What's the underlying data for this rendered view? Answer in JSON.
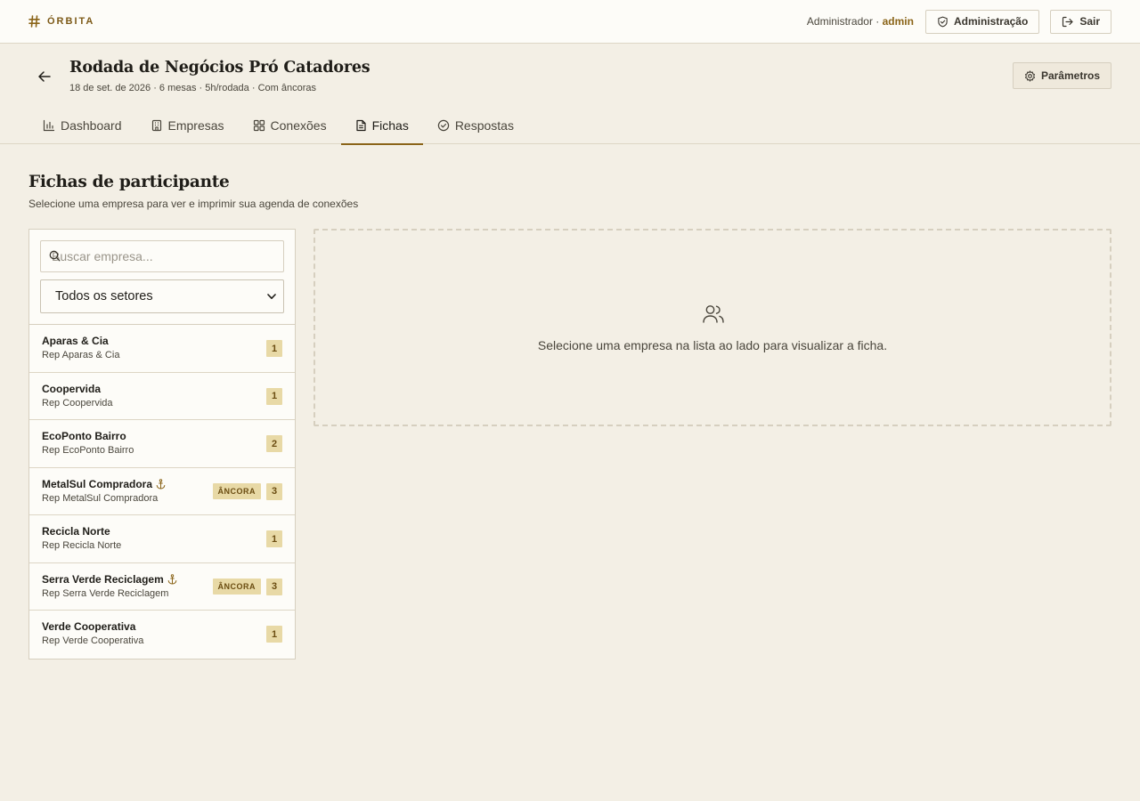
{
  "app": {
    "brand": "ÓRBITA",
    "user_role": "Administrador ·",
    "username": "admin",
    "admin_button": "Administração",
    "logout_button": "Sair"
  },
  "event": {
    "title": "Rodada de Negócios Pró Catadores",
    "meta": "18 de set. de 2026 · 6 mesas · 5h/rodada · Com âncoras",
    "params_button": "Parâmetros"
  },
  "tabs": [
    {
      "label": "Dashboard",
      "icon": "bar-chart-icon"
    },
    {
      "label": "Empresas",
      "icon": "building-icon"
    },
    {
      "label": "Conexões",
      "icon": "grid-icon"
    },
    {
      "label": "Fichas",
      "icon": "document-icon",
      "active": true
    },
    {
      "label": "Respostas",
      "icon": "check-circle-icon"
    }
  ],
  "page": {
    "title": "Fichas de participante",
    "subtitle": "Selecione uma empresa para ver e imprimir sua agenda de conexões"
  },
  "search": {
    "placeholder": "Buscar empresa...",
    "value": ""
  },
  "sector_filter": {
    "selected": "Todos os setores"
  },
  "anchor_label": "ÂNCORA",
  "companies": [
    {
      "name": "Aparas & Cia",
      "rep": "Rep Aparas & Cia",
      "count": "1",
      "anchor": false
    },
    {
      "name": "Coopervida",
      "rep": "Rep Coopervida",
      "count": "1",
      "anchor": false
    },
    {
      "name": "EcoPonto Bairro",
      "rep": "Rep EcoPonto Bairro",
      "count": "2",
      "anchor": false
    },
    {
      "name": "MetalSul Compradora",
      "rep": "Rep MetalSul Compradora",
      "count": "3",
      "anchor": true
    },
    {
      "name": "Recicla Norte",
      "rep": "Rep Recicla Norte",
      "count": "1",
      "anchor": false
    },
    {
      "name": "Serra Verde Reciclagem",
      "rep": "Rep Serra Verde Reciclagem",
      "count": "3",
      "anchor": true
    },
    {
      "name": "Verde Cooperativa",
      "rep": "Rep Verde Cooperativa",
      "count": "1",
      "anchor": false
    }
  ],
  "empty_state": {
    "icon": "users-icon",
    "message": "Selecione uma empresa na lista ao lado para visualizar a ficha."
  },
  "colors": {
    "accent": "#8a6418",
    "background": "#f3efe5",
    "badge": "#e8d9a6"
  }
}
